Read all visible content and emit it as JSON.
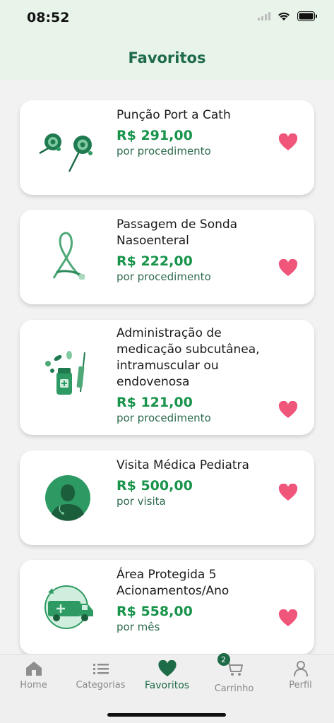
{
  "status_bar": {
    "time": "08:52"
  },
  "header": {
    "title": "Favoritos"
  },
  "favorites": [
    {
      "name": "Punção Port a Cath",
      "price": "R$ 291,00",
      "unit": "por procedimento",
      "image_icon": "port-a-cath-icon"
    },
    {
      "name": "Passagem de Sonda Nasoenteral",
      "price": "R$ 222,00",
      "unit": "por procedimento",
      "image_icon": "probe-tube-icon"
    },
    {
      "name": "Administração de medicação subcutânea, intramuscular ou endovenosa",
      "price": "R$ 121,00",
      "unit": "por procedimento",
      "image_icon": "medication-syringe-icon"
    },
    {
      "name": "Visita Médica Pediatra",
      "price": "R$ 500,00",
      "unit": "por visita",
      "image_icon": "doctor-avatar-icon"
    },
    {
      "name": "Área Protegida 5 Acionamentos/Ano",
      "price": "R$ 558,00",
      "unit": "por mês",
      "image_icon": "ambulance-icon"
    }
  ],
  "tab_bar": {
    "tabs": [
      {
        "label": "Home",
        "icon": "home-icon"
      },
      {
        "label": "Categorias",
        "icon": "list-icon"
      },
      {
        "label": "Favoritos",
        "icon": "heart-icon"
      },
      {
        "label": "Carrinho",
        "icon": "cart-icon"
      },
      {
        "label": "Perfil",
        "icon": "person-icon"
      }
    ],
    "active_tab": "Favoritos",
    "cart_badge": "2"
  },
  "colors": {
    "brand_green": "#1e6b47",
    "price_green": "#17934a",
    "heart_pink": "#f0557a",
    "header_bg": "#e8f3ea"
  }
}
